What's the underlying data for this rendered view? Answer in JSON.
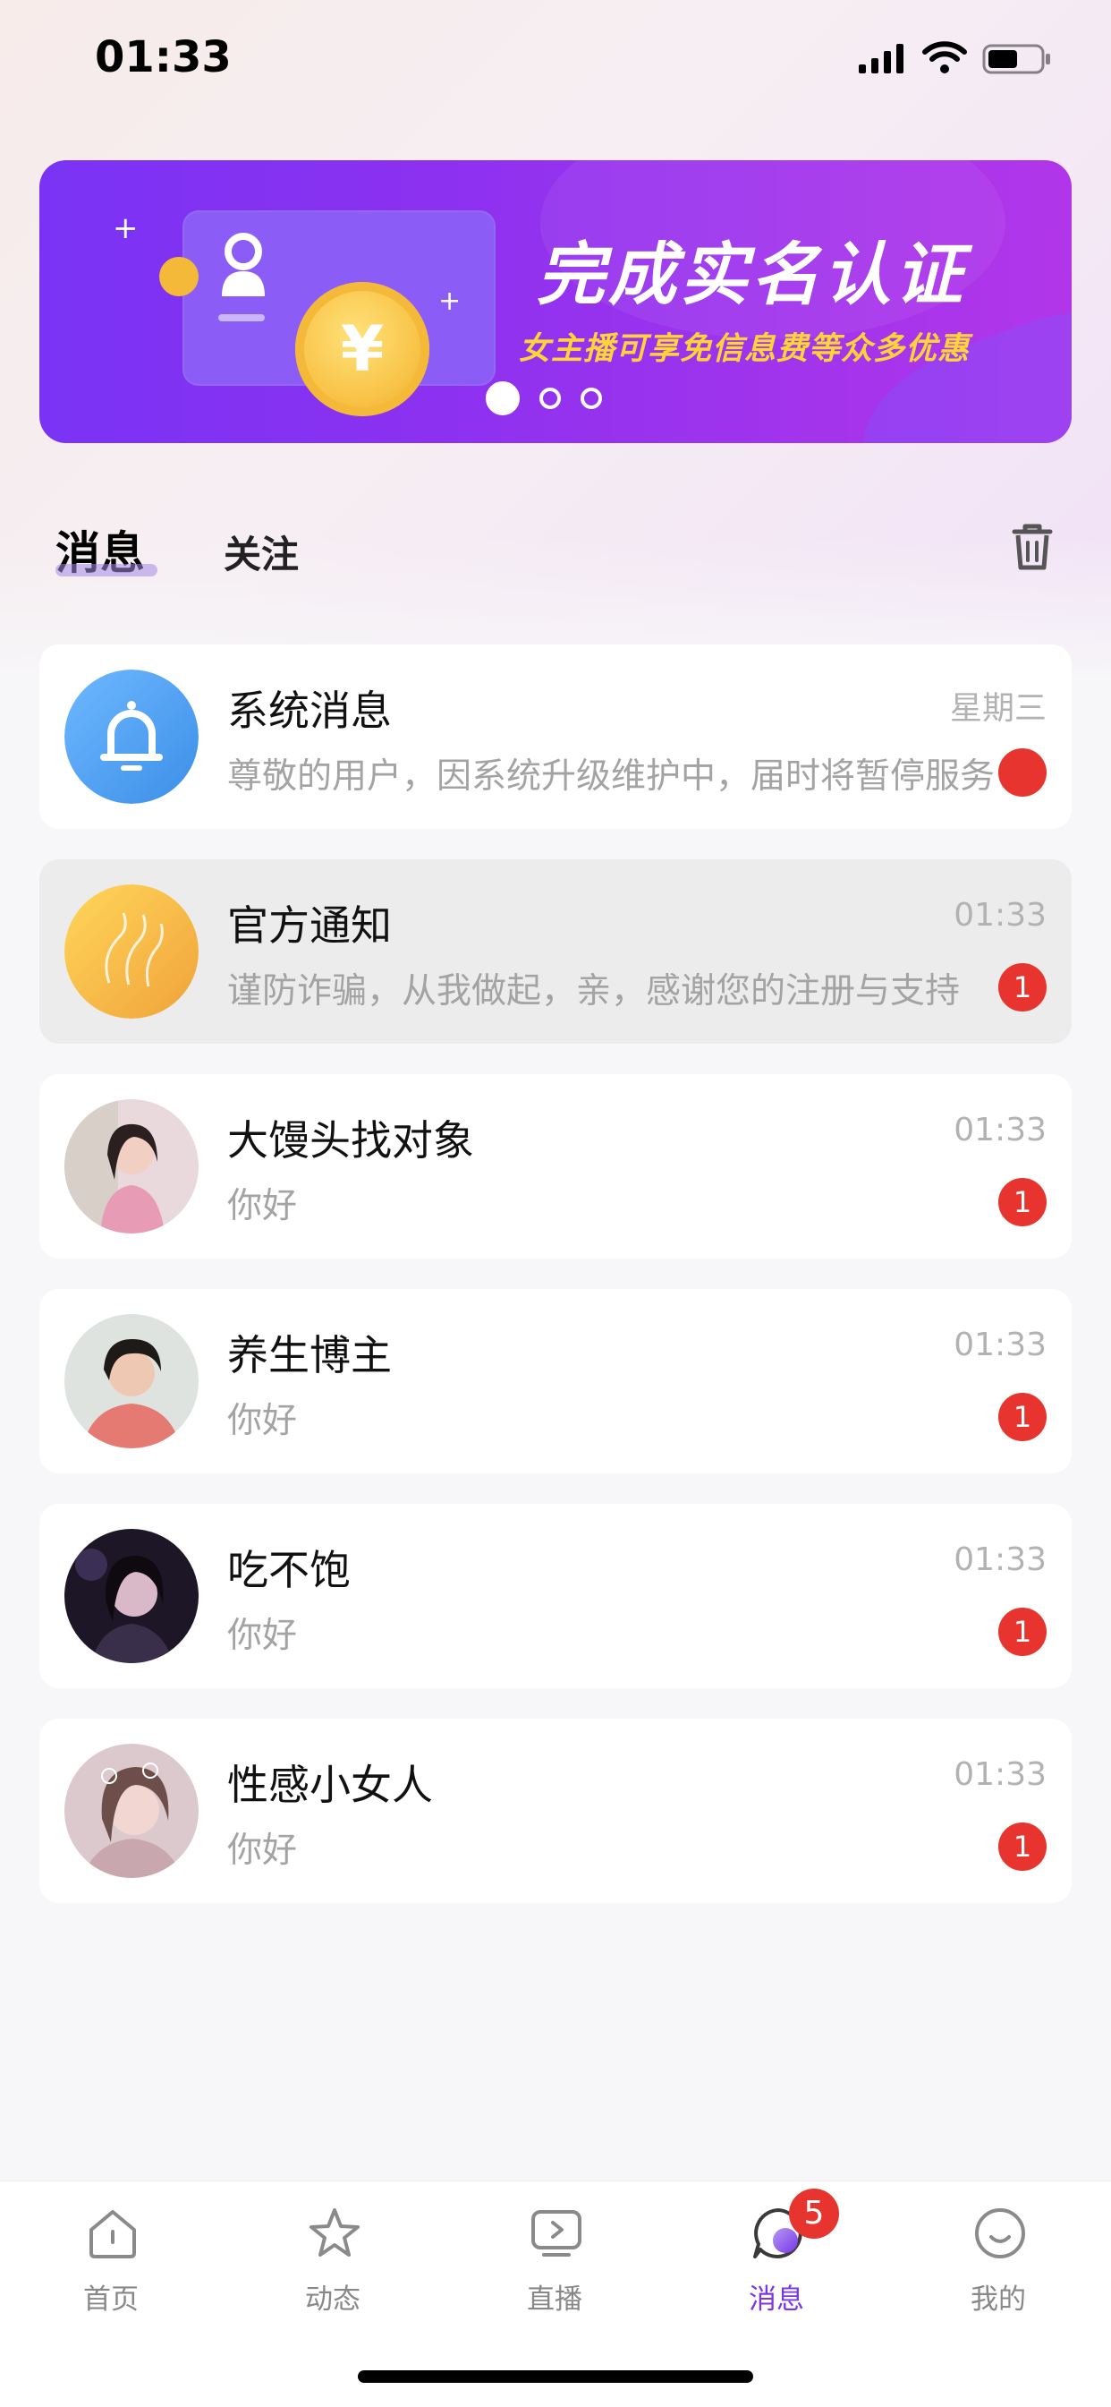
{
  "status_bar": {
    "time": "01:33"
  },
  "banner": {
    "title": "完成实名认证",
    "subtitle": "女主播可享免信息费等众多优惠",
    "coin_symbol": "¥",
    "pages": 3,
    "active_page": 1
  },
  "tabs": {
    "messages": "消息",
    "following": "关注"
  },
  "conversations": [
    {
      "name": "系统消息",
      "preview": "尊敬的用户，因系统升级维护中，届时将暂停服务",
      "time": "星期三",
      "badge": "",
      "avatar": "bell-icon"
    },
    {
      "name": "官方通知",
      "preview": "谨防诈骗，从我做起，亲，感谢您的注册与支持",
      "time": "01:33",
      "badge": "1",
      "avatar": "official-logo"
    },
    {
      "name": "大馒头找对象",
      "preview": "你好",
      "time": "01:33",
      "badge": "1",
      "avatar": "user-photo"
    },
    {
      "name": "养生博主",
      "preview": "你好",
      "time": "01:33",
      "badge": "1",
      "avatar": "user-photo"
    },
    {
      "name": "吃不饱",
      "preview": "你好",
      "time": "01:33",
      "badge": "1",
      "avatar": "user-photo"
    },
    {
      "name": "性感小女人",
      "preview": "你好",
      "time": "01:33",
      "badge": "1",
      "avatar": "user-photo"
    }
  ],
  "bottom_nav": {
    "items": [
      {
        "label": "首页",
        "icon": "home-icon"
      },
      {
        "label": "动态",
        "icon": "star-icon"
      },
      {
        "label": "直播",
        "icon": "live-tv-icon"
      },
      {
        "label": "消息",
        "icon": "chat-bubble-icon",
        "badge": "5",
        "active": true
      },
      {
        "label": "我的",
        "icon": "smiley-icon"
      }
    ]
  },
  "colors": {
    "accent": "#7a35e6",
    "badge": "#e8342e",
    "banner_start": "#7a33f4",
    "banner_end": "#b236e9"
  }
}
